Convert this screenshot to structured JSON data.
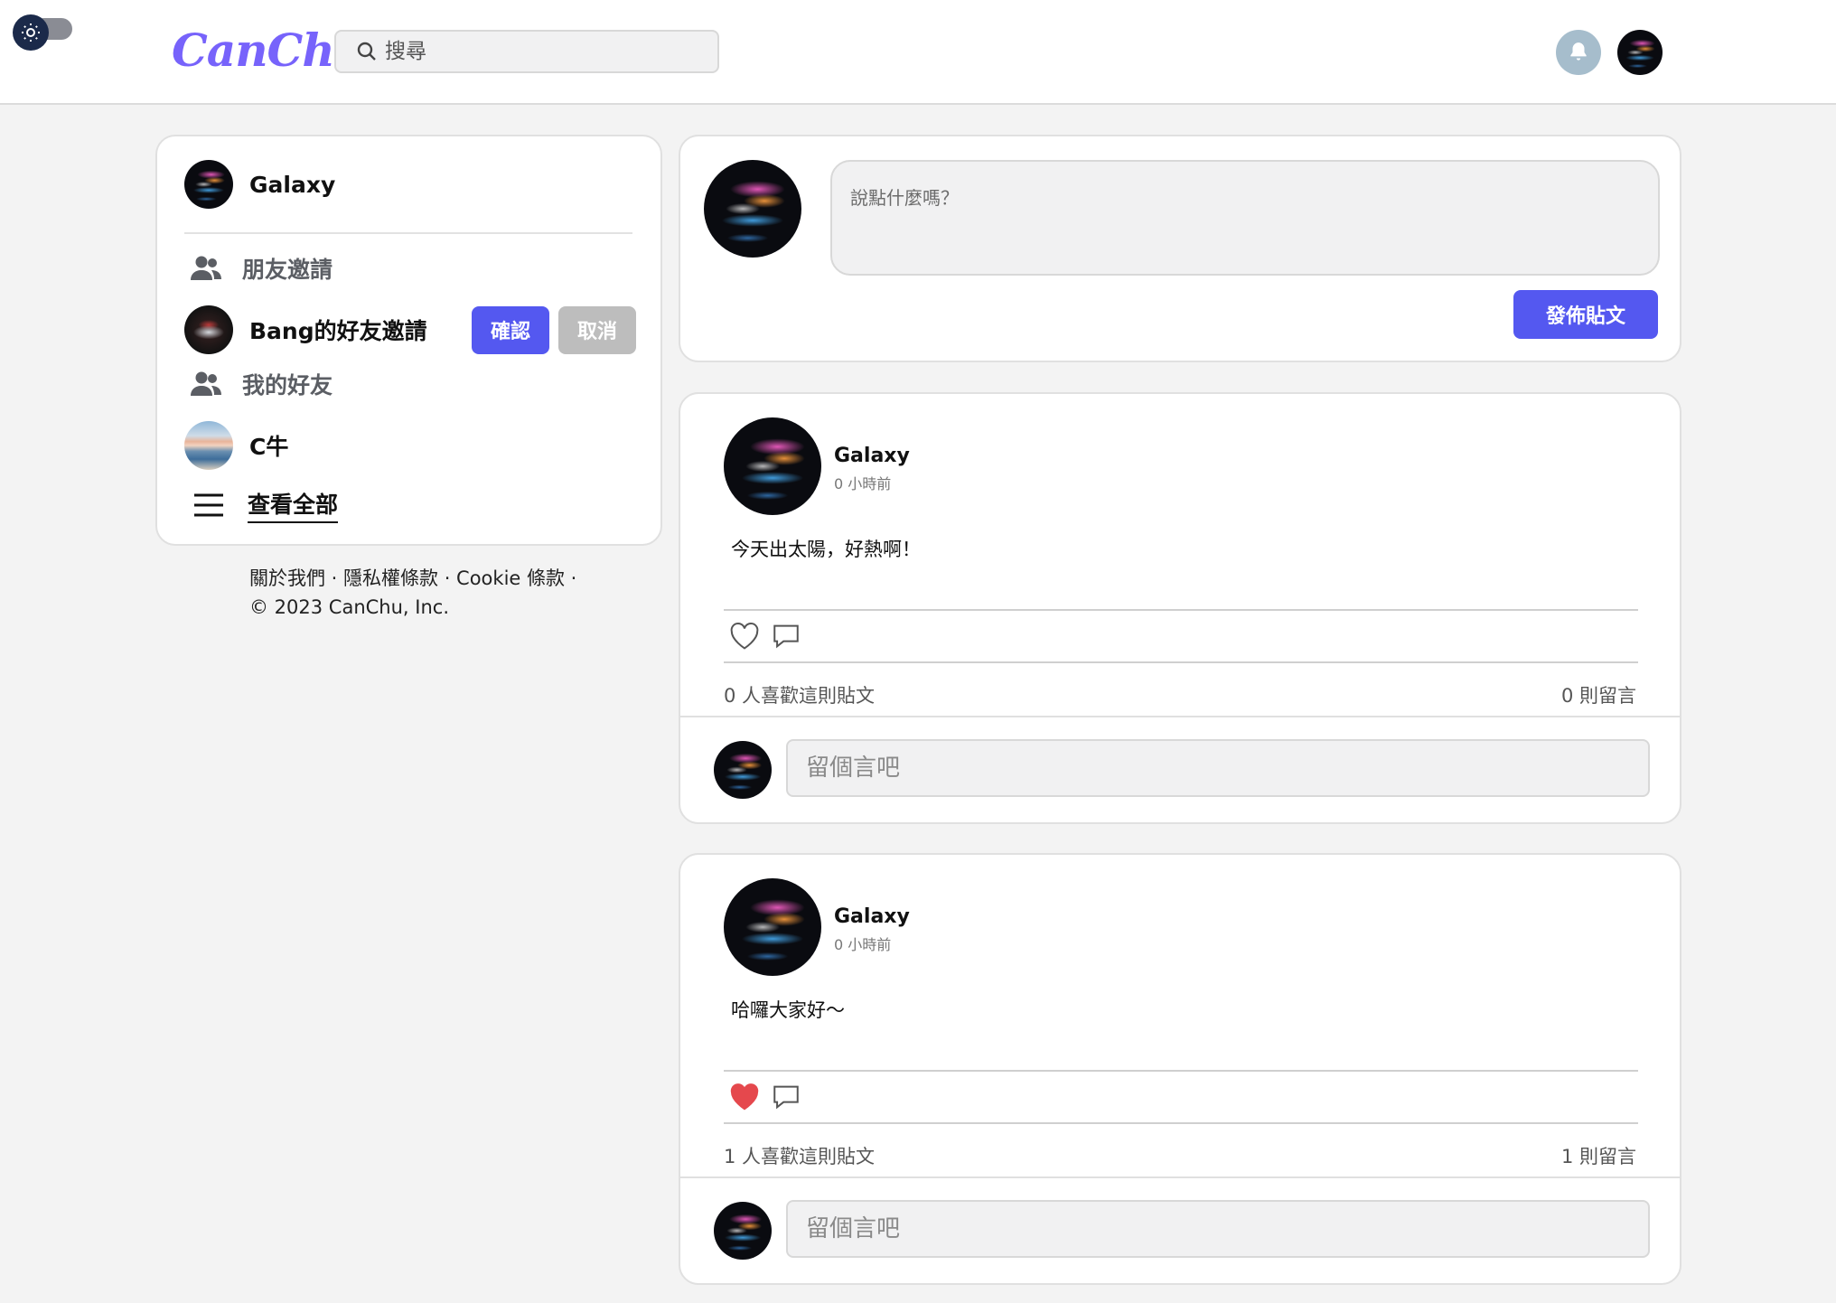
{
  "app": {
    "logo": "CanChu"
  },
  "header": {
    "search_placeholder": "搜尋",
    "icons": [
      "theme-toggle",
      "bell-icon",
      "user-avatar"
    ]
  },
  "sidebar": {
    "user_name": "Galaxy",
    "friend_requests_label": "朋友邀請",
    "request": {
      "name": "Bang的好友邀請",
      "confirm": "確認",
      "cancel": "取消"
    },
    "my_friends_label": "我的好友",
    "friends": [
      {
        "name": "C牛"
      }
    ],
    "view_all_label": "查看全部"
  },
  "footer": {
    "links": "關於我們 · 隱私權條款 · Cookie 條款 ·",
    "copyright": "© 2023 CanChu, Inc."
  },
  "composer": {
    "placeholder": "說點什麼嗎？",
    "post_button": "發佈貼文"
  },
  "posts": [
    {
      "author": "Galaxy",
      "time": "0 小時前",
      "content": "今天出太陽，好熱啊！",
      "liked": false,
      "likes_text": "0 人喜歡這則貼文",
      "comments_text": "0 則留言",
      "comment_placeholder": "留個言吧"
    },
    {
      "author": "Galaxy",
      "time": "0 小時前",
      "content": "哈囉大家好～",
      "liked": true,
      "likes_text": "1 人喜歡這則貼文",
      "comments_text": "1 則留言",
      "comment_placeholder": "留個言吧"
    }
  ],
  "colors": {
    "brand": "#7763fb",
    "primary_button": "#5458f0",
    "cancel_button": "#bdbdbd",
    "like_red": "#e5484d"
  }
}
